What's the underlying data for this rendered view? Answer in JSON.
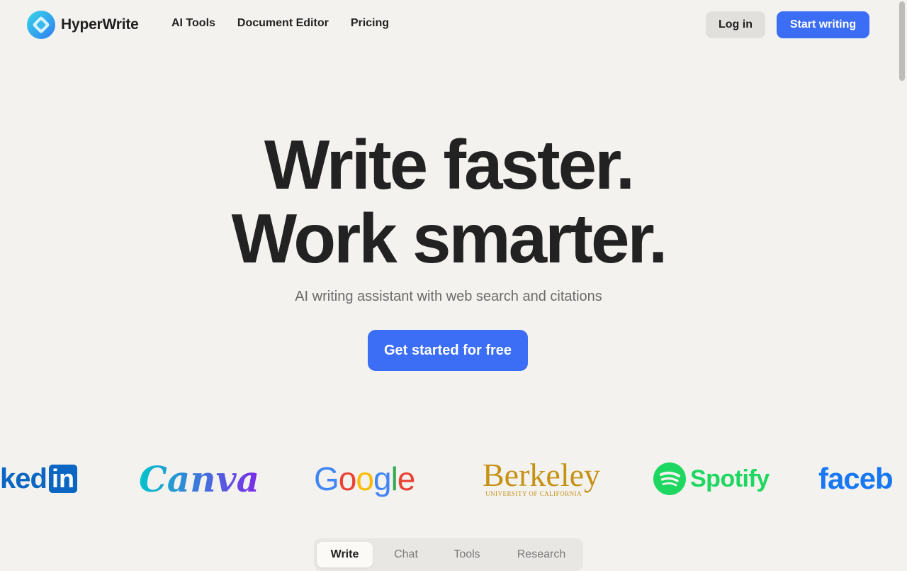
{
  "brand": {
    "name": "HyperWrite",
    "accent": "#3b6ef5"
  },
  "nav": {
    "links": [
      "AI Tools",
      "Document Editor",
      "Pricing"
    ],
    "login_label": "Log in",
    "start_label": "Start writing"
  },
  "hero": {
    "title_line1": "Write faster.",
    "title_line2": "Work smarter.",
    "subtitle": "AI writing assistant with web search and citations",
    "cta_label": "Get started for free"
  },
  "logos": {
    "linkedin_text": "ked",
    "linkedin_box": "in",
    "canva": "Canva",
    "google": [
      "G",
      "o",
      "o",
      "g",
      "l",
      "e"
    ],
    "berkeley": "Berkeley",
    "berkeley_sub": "UNIVERSITY OF CALIFORNIA",
    "spotify": "Spotify",
    "facebook": "faceb"
  },
  "tabs": {
    "items": [
      "Write",
      "Chat",
      "Tools",
      "Research"
    ],
    "active": "Write"
  }
}
